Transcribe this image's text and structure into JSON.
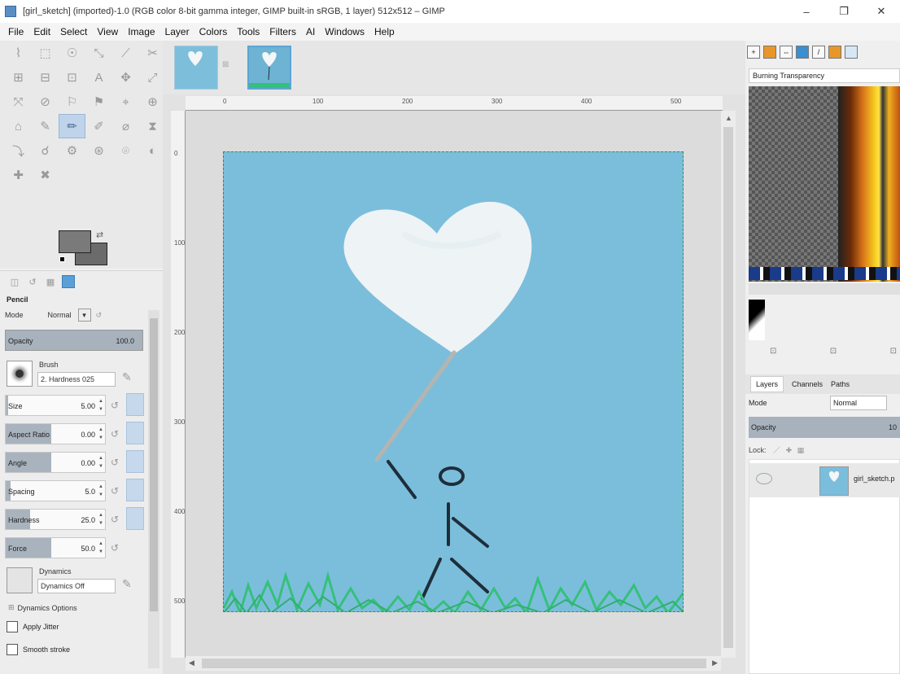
{
  "window": {
    "title": "[girl_sketch] (imported)-1.0 (RGB color 8-bit gamma integer, GIMP built-in sRGB, 1 layer) 512x512 – GIMP",
    "minimize": "–",
    "maximize": "❐",
    "close": "✕"
  },
  "menu": [
    "File",
    "Edit",
    "Select",
    "View",
    "Image",
    "Layer",
    "Colors",
    "Tools",
    "Filters",
    "AI",
    "Windows",
    "Help"
  ],
  "tools": [
    "⌇",
    "⬚",
    "☉",
    "⤡",
    "⟋",
    "✂",
    "⊞",
    "⊟",
    "⊡",
    "A",
    "✥",
    "⤢",
    "⤧",
    "⊘",
    "⚐",
    "⚑",
    "⌖",
    "⊕",
    "⌂",
    "✎",
    "✏",
    "✐",
    "⌀",
    "⧗",
    "⤵",
    "☌",
    "⚙",
    "⊛",
    "⌾",
    "◐",
    "✚",
    "✖"
  ],
  "tool_options": {
    "title": "Pencil",
    "mode_label": "Mode",
    "mode_value": "Normal",
    "opacity_label": "Opacity",
    "opacity_value": "100.0",
    "brush_label": "Brush",
    "brush_value": "2. Hardness 025",
    "size_label": "Size",
    "size_value": "5.00",
    "aspect_label": "Aspect Ratio",
    "aspect_value": "0.00",
    "angle_label": "Angle",
    "angle_value": "0.00",
    "spacing_label": "Spacing",
    "spacing_value": "5.0",
    "hardness_label": "Hardness",
    "hardness_value": "25.0",
    "force_label": "Force",
    "force_value": "50.0",
    "dynamics_label": "Dynamics",
    "dynamics_value": "Dynamics Off",
    "dynamics_options": "Dynamics Options",
    "apply_jitter": "Apply Jitter",
    "smooth_stroke": "Smooth stroke"
  },
  "ruler": {
    "h_labels": [
      "0",
      "100",
      "200",
      "300",
      "400",
      "500"
    ],
    "v_labels": [
      "0",
      "100",
      "200",
      "300",
      "400",
      "500"
    ]
  },
  "right_dock": {
    "gradient_name": "Burning Transparency",
    "layers_tab": "Layers",
    "channels_tab": "Channels",
    "paths_tab": "Paths",
    "mode_label": "Mode",
    "mode_value": "Normal",
    "opacity_label": "Opacity",
    "opacity_value": "10",
    "lock_label": "Lock:",
    "layer_name": "girl_sketch.p"
  },
  "colors": {
    "sky": "#7bbedb",
    "cloud": "#f4f6f8",
    "string": "#b4b4b0",
    "stick": "#1e2e3a",
    "grass": "#35c07a"
  }
}
